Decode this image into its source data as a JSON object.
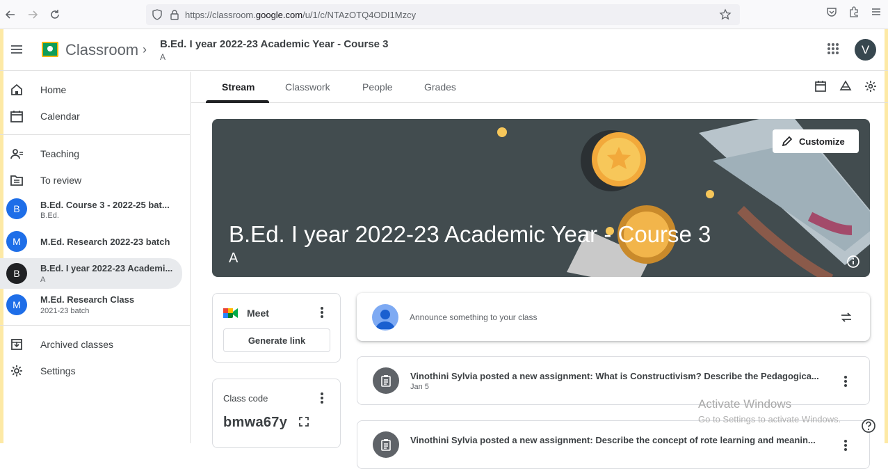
{
  "browser": {
    "url_prefix": "https://classroom.",
    "url_domain": "google.com",
    "url_path": "/u/1/c/NTAzOTQ4ODI1Mzcy"
  },
  "header": {
    "app_name": "Classroom",
    "breadcrumb_title": "B.Ed. I year 2022-23 Academic Year - Course 3",
    "breadcrumb_sub": "A",
    "avatar_letter": "V"
  },
  "sidebar": {
    "home": "Home",
    "calendar": "Calendar",
    "teaching": "Teaching",
    "to_review": "To review",
    "classes": [
      {
        "letter": "B",
        "name": "B.Ed. Course 3 - 2022-25 bat...",
        "sub": "B.Ed.",
        "color": "#1e6ee8"
      },
      {
        "letter": "M",
        "name": "M.Ed. Research 2022-23 batch",
        "sub": "",
        "color": "#1e6ee8"
      },
      {
        "letter": "B",
        "name": "B.Ed. I year 2022-23 Academi...",
        "sub": "A",
        "color": "#202124"
      },
      {
        "letter": "M",
        "name": "M.Ed. Research Class",
        "sub": "2021-23 batch",
        "color": "#1e6ee8"
      }
    ],
    "archived": "Archived classes",
    "settings": "Settings"
  },
  "tabs": {
    "stream": "Stream",
    "classwork": "Classwork",
    "people": "People",
    "grades": "Grades"
  },
  "banner": {
    "title": "B.Ed. I year 2022-23 Academic Year - Course 3",
    "subtitle": "A",
    "customize": "Customize"
  },
  "meet": {
    "title": "Meet",
    "generate": "Generate link"
  },
  "class_code": {
    "label": "Class code",
    "value": "bmwa67y"
  },
  "announce": {
    "placeholder": "Announce something to your class"
  },
  "posts": [
    {
      "title": "Vinothini Sylvia posted a new assignment: What is Constructivism? Describe the Pedagogica...",
      "date": "Jan 5"
    },
    {
      "title": "Vinothini Sylvia posted a new assignment: Describe the concept of rote learning and meanin...",
      "date": ""
    }
  ],
  "watermark": {
    "line1": "Activate Windows",
    "line2": "Go to Settings to activate Windows."
  }
}
